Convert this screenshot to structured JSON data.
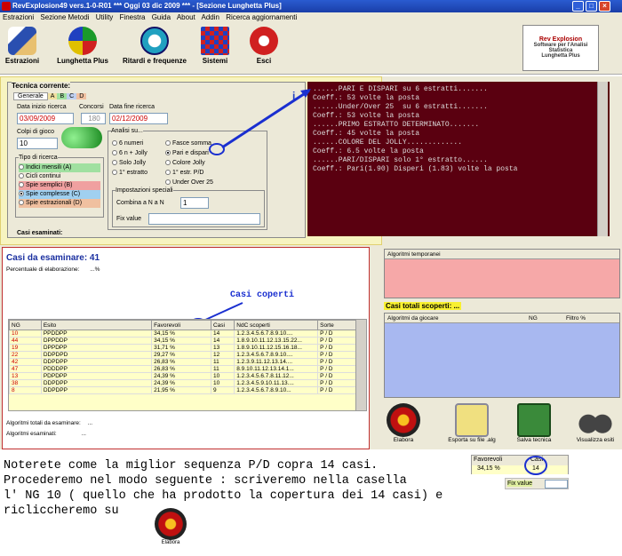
{
  "window": {
    "title": "RevExplosion49 vers.1-0-R01  ***  Oggi 03 dic 2009  ***  - [Sezione Lunghetta Plus]"
  },
  "menu": [
    "Estrazioni",
    "Sezione Metodi",
    "Utility",
    "Finestra",
    "Guida",
    "About",
    "Addin",
    "Ricerca aggiornamenti"
  ],
  "toolbar": {
    "items": [
      {
        "label": "Estrazioni",
        "icon": "pencil-icon"
      },
      {
        "label": "Lunghetta Plus",
        "icon": "color-square-icon"
      },
      {
        "label": "Ritardi e frequenze",
        "icon": "clock-icon"
      },
      {
        "label": "Sistemi",
        "icon": "grid-icon"
      },
      {
        "label": "Esci",
        "icon": "power-icon"
      }
    ],
    "logo_text": "Rev Explosion",
    "logo_sub1": "Software per l'Analisi Statistica",
    "logo_sub2": "Lunghetta Plus"
  },
  "tecnica": {
    "title": "Tecnica corrente:",
    "tabs": [
      "Generale",
      "A",
      "B",
      "C",
      "D"
    ],
    "data_inizio_label": "Data inizio ricerca",
    "data_inizio": "03/09/2009",
    "concorsi_label": "Concorsi",
    "concorsi": "180",
    "data_fine_label": "Data fine ricerca",
    "data_fine": "02/12/2009",
    "colpi_label": "Colpi di gioco",
    "colpi": "10",
    "tipo_title": "Tipo di ricerca",
    "tipo_items": [
      "Indici mensili (A)",
      "Cicli continui",
      "Spie semplici (B)",
      "Spie complesse (C)",
      "Spie estrazionali (D)"
    ],
    "analisi_title": "Analisi su...",
    "analisi_left": [
      "6 numeri",
      "6 n + Jolly",
      "Solo Jolly",
      "1° estratto"
    ],
    "analisi_right": [
      "Fasce somma",
      "Pari e dispari",
      "Colore Jolly",
      "1° estr. P/D",
      "Under Over 25"
    ],
    "impostazioni_title": "Impostazioni speciali",
    "combina_label": "Combina a N a N",
    "combina_value": "1",
    "fix_label": "Fix value",
    "casi_esaminati_label": "Casi esaminati:"
  },
  "console": {
    "lines": [
      "......PARI E DISPARI su 6 estratti.......",
      "Coeff.: 53 volte la posta",
      "",
      "......Under/Over 25  su 6 estratti.......",
      "Coeff.: 53 volte la posta",
      "",
      "......PRIMO ESTRATTO DETERMINATO.......",
      "Coeff.: 45 volte la posta",
      "",
      "......COLORE DEL JOLLY.............",
      "Coeff.: 6.5 volte la posta",
      "",
      "......PARI/DISPARI solo 1° estratto......",
      "Coeff.: Pari(1.90) Disperi (1.83) volte la posta"
    ]
  },
  "casi": {
    "title": "Casi da esaminare: 41",
    "percentuale_label": "Percentuale di elaborazione:",
    "percentuale_value": "...%",
    "annotation": "Casi coperti",
    "columns": [
      "NG",
      "Esito",
      "Favorevoli",
      "Casi",
      "NdC scoperti",
      "Sorte"
    ],
    "rows": [
      [
        "10",
        "PPDDPP",
        "34,15 %",
        "14",
        "1.2.3.4.5.6.7.8.9.10....",
        "P / D"
      ],
      [
        "44",
        "DPPDDP",
        "34,15 %",
        "14",
        "1.8.9.10.11.12.13.15.22...",
        "P / D"
      ],
      [
        "19",
        "DPPDPP",
        "31,71 %",
        "13",
        "1.8.9.10.11.12.15.16.18...",
        "P / D"
      ],
      [
        "22",
        "DDPDPD",
        "29,27 %",
        "12",
        "1.2.3.4.5.6.7.8.9.10....",
        "P / D"
      ],
      [
        "42",
        "DDPDPP",
        "26,83 %",
        "11",
        "1.2.3.9.11.12.13.14....",
        "P / D"
      ],
      [
        "47",
        "PDDDPP",
        "26,83 %",
        "11",
        "8.9.10.11.12.13.14.1...",
        "P / D"
      ],
      [
        "13",
        "PDPDPP",
        "24,39 %",
        "10",
        "1.2.3.4.5.6.7.8.11.12...",
        "P / D"
      ],
      [
        "38",
        "DDPDPP",
        "24,39 %",
        "10",
        "1.2.3.4.5.9.10.11.13....",
        "P / D"
      ],
      [
        "8",
        "DDPDPP",
        "21,95 %",
        "9",
        "1.2.3.4.5.6.7.8.9.10...",
        "P / D"
      ]
    ],
    "totali_label": "Algoritmi totali da esaminare:",
    "totali_value": "...",
    "esaminati_label": "Algoritmi esaminati:",
    "esaminati_value": "..."
  },
  "right": {
    "temporanei_title": "Algoritmi temporanei",
    "scoperti_title": "Casi totali scoperti: ...",
    "cols": [
      "Algoritmi da giocare",
      "NG",
      "Filtro %"
    ]
  },
  "actions": [
    {
      "label": "Elabora",
      "icon": "target-button-icon"
    },
    {
      "label": "Esporta su file .alg",
      "icon": "export-disk-icon"
    },
    {
      "label": "Salva tecnica",
      "icon": "save-disk-icon"
    },
    {
      "label": "Visualizza esiti",
      "icon": "binoculars-icon"
    }
  ],
  "note": {
    "line1": "Noterete come la miglior sequenza P/D copra 14 casi.",
    "line2": "Procederemo nel modo seguente : scriveremo nella casella",
    "line3": "l' NG 10 ( quello che ha prodotto la copertura dei 14 casi) e",
    "line4": "ricliccheremo su",
    "inset_favorevoli": "Favorevoli",
    "inset_casi": "Casi",
    "inset_pct": "34,15 %",
    "inset_val": "14",
    "inset_fix": "Fix value",
    "elabora_small": "Elabora"
  },
  "colors": {
    "console_bg": "#5a0010",
    "highlight_yellow": "#ffffc8",
    "pink_panel": "#f6a8a8",
    "blue_panel": "#a8b8f0",
    "annotation_blue": "#1a2fd0"
  }
}
